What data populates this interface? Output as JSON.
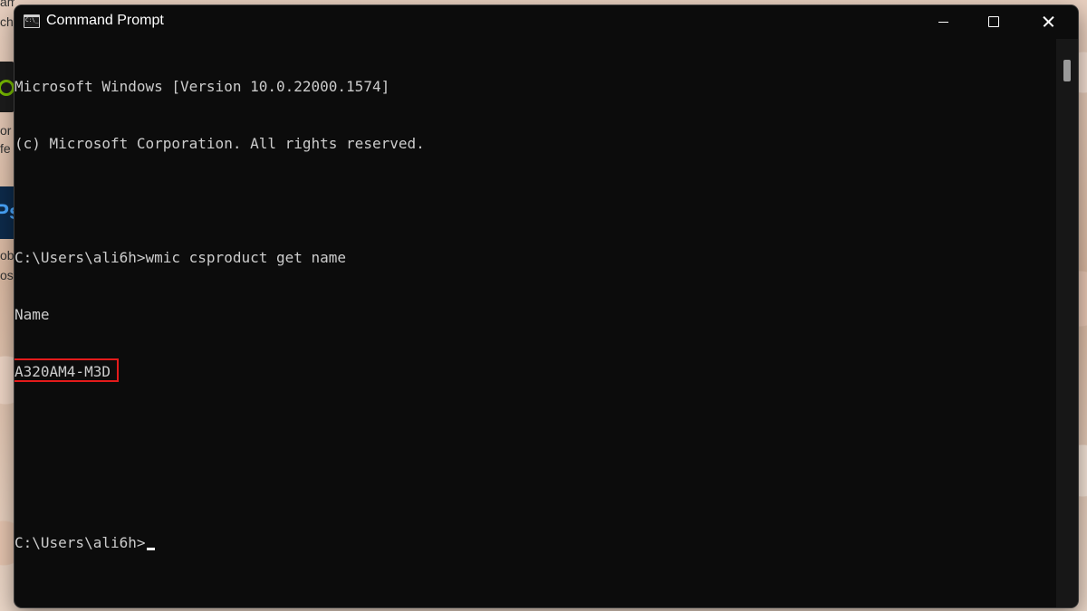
{
  "desktop": {
    "left_fragments": [
      "ames",
      "ch",
      "or",
      "fe",
      "ob",
      "os"
    ]
  },
  "window": {
    "title": "Command Prompt",
    "icon": "cmd-icon"
  },
  "console": {
    "lines": [
      "Microsoft Windows [Version 10.0.22000.1574]",
      "(c) Microsoft Corporation. All rights reserved.",
      "",
      "C:\\Users\\ali6h>wmic csproduct get name",
      "Name",
      "A320AM4-M3D",
      "",
      "",
      "C:\\Users\\ali6h>"
    ],
    "highlight_color": "#e41b1b",
    "text_color": "#cccccc",
    "background_color": "#0c0c0c"
  }
}
